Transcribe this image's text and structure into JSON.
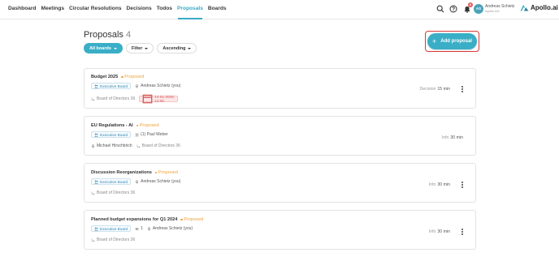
{
  "nav": {
    "items": [
      {
        "label": "Dashboard",
        "active": false
      },
      {
        "label": "Meetings",
        "active": false
      },
      {
        "label": "Circular Resolutions",
        "active": false
      },
      {
        "label": "Decisions",
        "active": false
      },
      {
        "label": "Todos",
        "active": false
      },
      {
        "label": "Proposals",
        "active": true
      },
      {
        "label": "Boards",
        "active": false
      }
    ]
  },
  "topbar": {
    "notification_count": "6",
    "avatar_initials": "AS",
    "user_name": "Andreas Schietz",
    "user_org": "Apollo AG",
    "logo_text": "Apollo.ai"
  },
  "header": {
    "title": "Proposals",
    "count": "4",
    "add_label": "Add proposal"
  },
  "filters": {
    "boards": "All boards",
    "filter": "Filter",
    "sort": "Ascending"
  },
  "proposals": [
    {
      "title": "Budget 2025",
      "status": "Proposed",
      "board": "Executive Board",
      "presenter": "Andreas Schietz (you)",
      "source": "Board of Directors 36",
      "date": "14.01.2025, 12:00",
      "type": "Decision",
      "duration": "15 min"
    },
    {
      "title": "EU Regulations - AI",
      "status": "Proposed",
      "board": "Executive Board",
      "participants": "(1) Paul Weber",
      "presenter": "Michael Hirschbrich",
      "source": "Board of Directors 36",
      "type": "Info",
      "duration": "30 min"
    },
    {
      "title": "Discussion Reorganizations",
      "status": "Proposed",
      "board": "Executive Board",
      "presenter": "Andreas Schietz (you)",
      "source": "Board of Directors 36",
      "type": "Info",
      "duration": "30 min"
    },
    {
      "title": "Planned budget expansions for Q1 2024",
      "status": "Proposed",
      "board": "Executive Board",
      "views": "1",
      "presenter": "Andreas Schietz (you)",
      "source": "Board of Directors 36",
      "type": "Info",
      "duration": "30 min"
    }
  ],
  "colors": {
    "accent": "#3aaec7",
    "status": "#f0a23a",
    "highlight": "#d93a3a"
  }
}
